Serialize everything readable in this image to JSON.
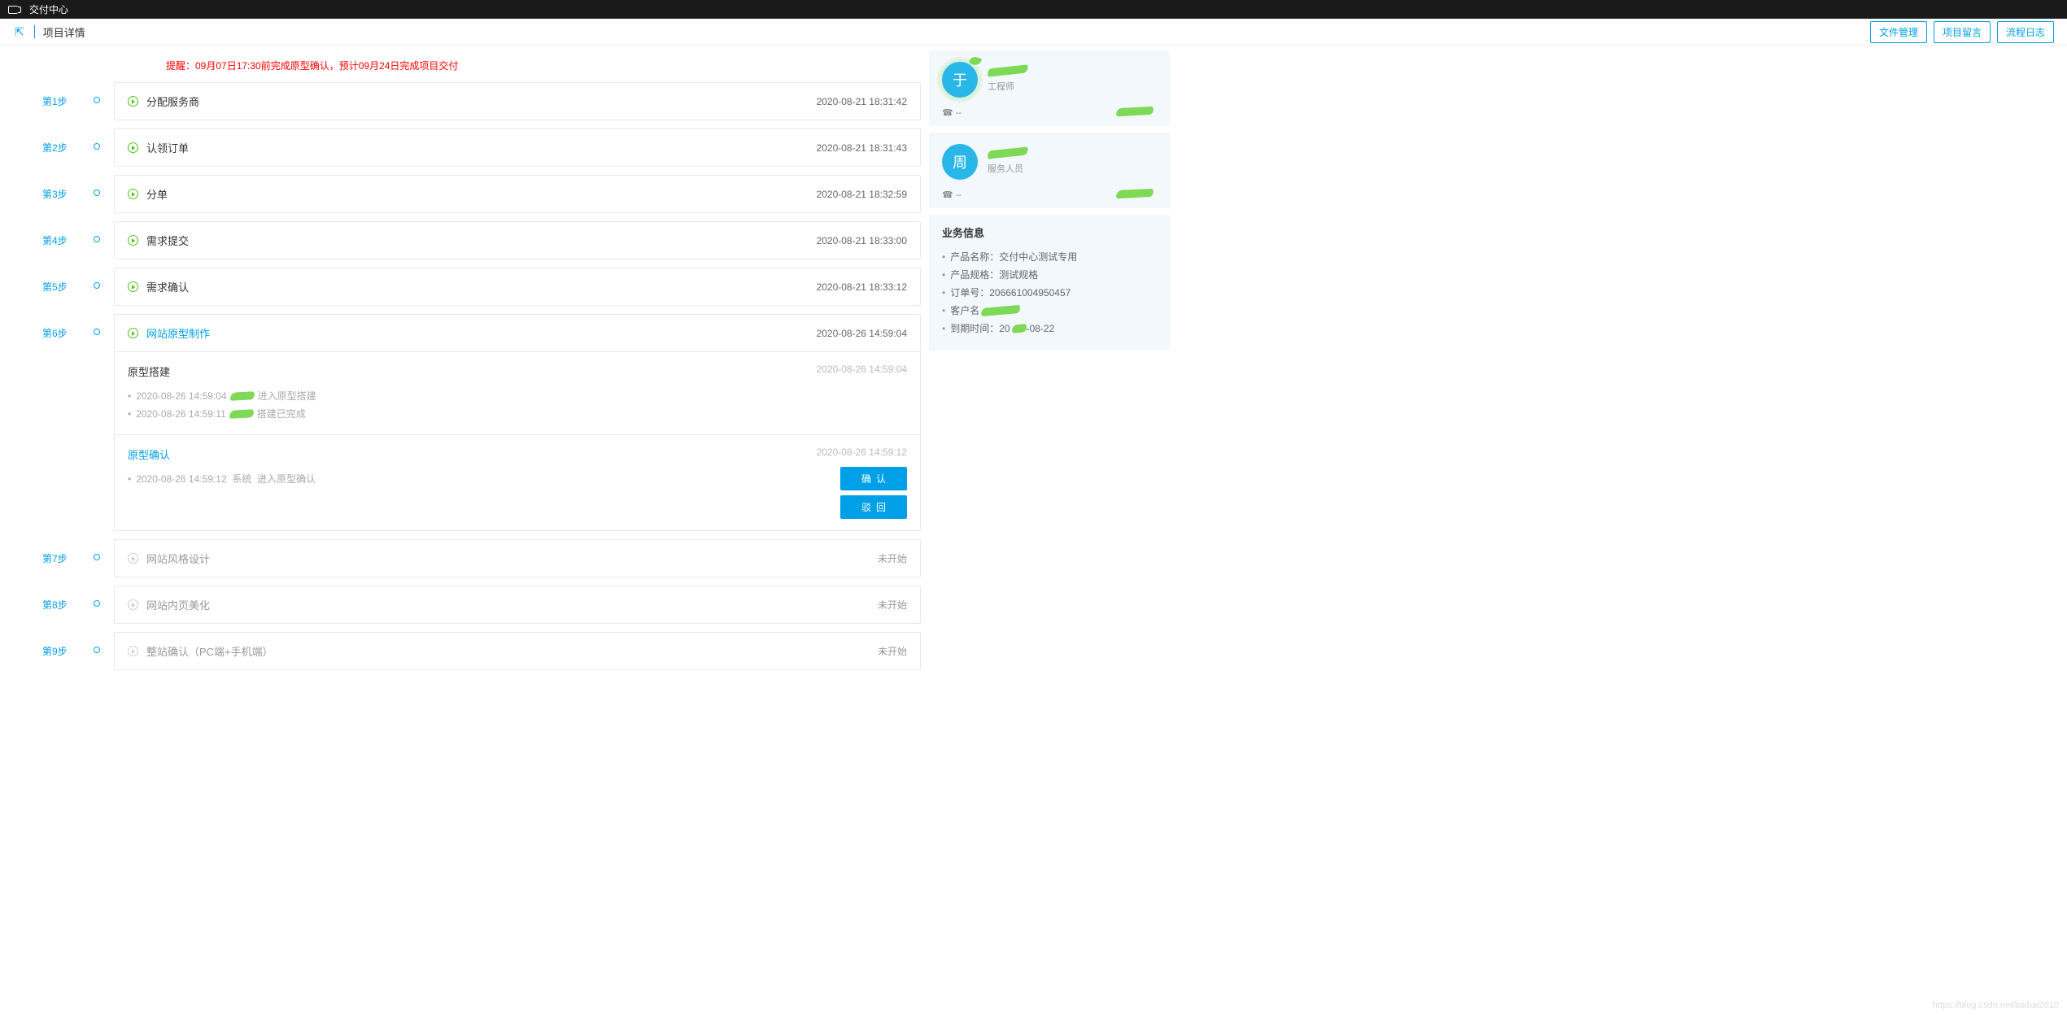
{
  "top": {
    "title": "交付中心"
  },
  "sub": {
    "page_title": "项目详情",
    "file_btn": "文件管理",
    "msg_btn": "项目留言",
    "log_btn": "流程日志"
  },
  "reminder": "提醒：09月07日17:30前完成原型确认，预计09月24日完成项目交付",
  "steps": [
    {
      "label": "第1步",
      "title": "分配服务商",
      "time": "2020-08-21 18:31:42",
      "state": "done"
    },
    {
      "label": "第2步",
      "title": "认领订单",
      "time": "2020-08-21 18:31:43",
      "state": "done"
    },
    {
      "label": "第3步",
      "title": "分单",
      "time": "2020-08-21 18:32:59",
      "state": "done"
    },
    {
      "label": "第4步",
      "title": "需求提交",
      "time": "2020-08-21 18:33:00",
      "state": "done"
    },
    {
      "label": "第5步",
      "title": "需求确认",
      "time": "2020-08-21 18:33:12",
      "state": "done"
    },
    {
      "label": "第6步",
      "title": "网站原型制作",
      "time": "2020-08-26 14:59:04",
      "state": "active"
    },
    {
      "label": "第7步",
      "title": "网站风格设计",
      "status_text": "未开始",
      "state": "pending"
    },
    {
      "label": "第8步",
      "title": "网站内页美化",
      "status_text": "未开始",
      "state": "pending"
    },
    {
      "label": "第9步",
      "title": "整站确认（PC端+手机端）",
      "status_text": "未开始",
      "state": "pending"
    }
  ],
  "step6": {
    "sub1": {
      "title": "原型搭建",
      "time": "2020-08-26 14:59:04",
      "log1_time": "2020-08-26 14:59:04",
      "log1_text": "进入原型搭建",
      "log2_time": "2020-08-26 14:59:11",
      "log2_text": "搭建已完成"
    },
    "sub2": {
      "title": "原型确认",
      "time": "2020-08-26 14:59:12",
      "log1_time": "2020-08-26 14:59:12",
      "log1_actor": "系统",
      "log1_text": "进入原型确认",
      "confirm": "确认",
      "reject": "驳回"
    }
  },
  "people": [
    {
      "avatar": "于",
      "role": "工程师",
      "phone": "☎ --",
      "ext": ""
    },
    {
      "avatar": "周",
      "role": "服务人员",
      "phone": "☎ --",
      "ext": ""
    }
  ],
  "biz": {
    "heading": "业务信息",
    "product_label": "产品名称：",
    "product": "交付中心测试专用",
    "spec_label": "产品规格：",
    "spec": "测试规格",
    "order_label": "订单号：",
    "order": "206661004950457",
    "cust_label": "客户名",
    "expire_label": "到期时间：",
    "expire_partial": "20",
    "expire_rest": "-08-22"
  },
  "watermark": "https://blog.csdn.net/baibai2010"
}
